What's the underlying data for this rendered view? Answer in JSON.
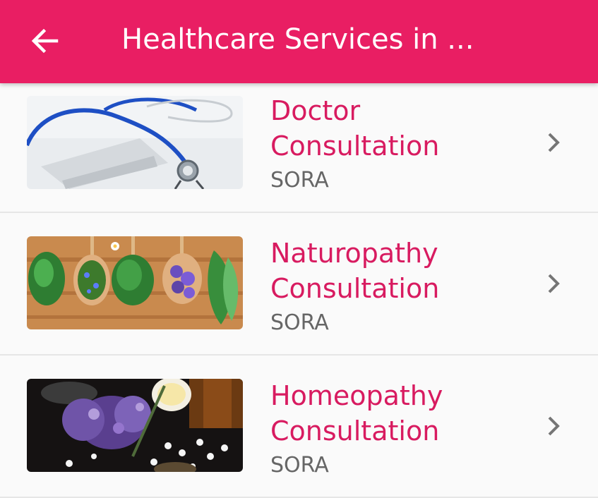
{
  "header": {
    "back_icon": "arrow-left-icon",
    "title": "Healthcare Services in ...",
    "background": "#e91e63"
  },
  "services": [
    {
      "name": "Doctor Consultation",
      "provider": "SORA",
      "image": "stethoscope-phone-photo"
    },
    {
      "name": "Naturopathy Consultation",
      "provider": "SORA",
      "image": "herbs-on-spoons-photo"
    },
    {
      "name": "Homeopathy Consultation",
      "provider": "SORA",
      "image": "homeopathy-pills-flowers-photo"
    }
  ],
  "colors": {
    "accent": "#d81b60",
    "secondary_text": "#666666",
    "chevron": "#757575"
  }
}
